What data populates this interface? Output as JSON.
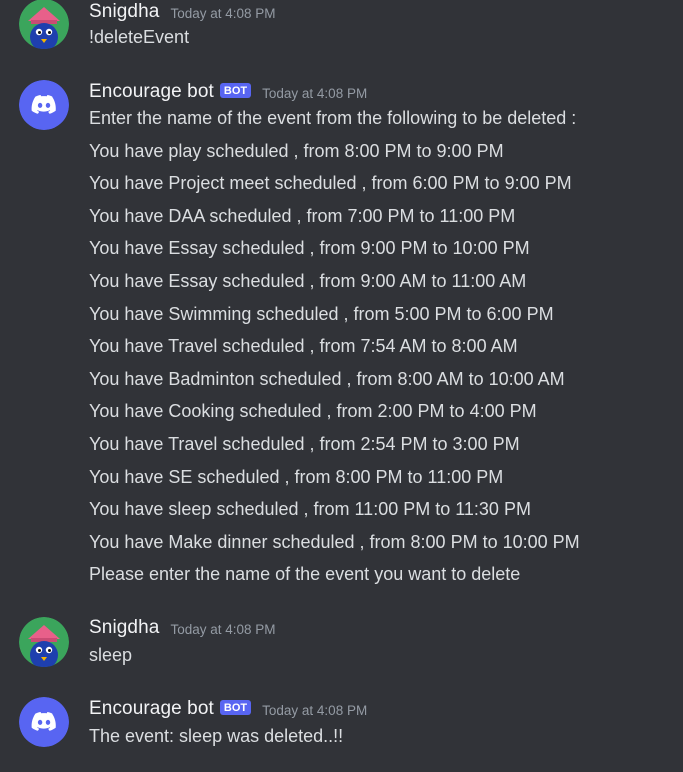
{
  "messages": [
    {
      "author": "Snigdha",
      "avatar_icon": "user-avatar-icon",
      "is_bot": false,
      "timestamp": "Today at 4:08 PM",
      "lines": [
        "!deleteEvent"
      ]
    },
    {
      "author": "Encourage bot",
      "avatar_icon": "discord-logo-icon",
      "is_bot": true,
      "badge": "BOT",
      "timestamp": "Today at 4:08 PM",
      "lines": [
        "Enter the name of the event from the following to be deleted :",
        "You have play scheduled , from 8:00 PM to 9:00 PM",
        "You have Project meet scheduled , from 6:00 PM to 9:00 PM",
        "You have DAA scheduled , from 7:00 PM to 11:00 PM",
        "You have Essay scheduled , from 9:00 PM to 10:00 PM",
        "You have Essay scheduled , from 9:00 AM to 11:00 AM",
        "You have Swimming scheduled , from 5:00 PM to 6:00 PM",
        "You have Travel scheduled , from 7:54 AM to 8:00 AM",
        "You have Badminton scheduled , from 8:00 AM to 10:00 AM",
        "You have Cooking scheduled , from 2:00 PM to 4:00 PM",
        "You have Travel scheduled , from 2:54 PM to 3:00 PM",
        "You have SE scheduled , from 8:00 PM to 11:00 PM",
        "You have sleep scheduled , from 11:00 PM to 11:30 PM",
        "You have Make dinner scheduled , from 8:00 PM to 10:00 PM",
        "Please enter the name of the event you want to delete"
      ]
    },
    {
      "author": "Snigdha",
      "avatar_icon": "user-avatar-icon",
      "is_bot": false,
      "timestamp": "Today at 4:08 PM",
      "lines": [
        "sleep"
      ]
    },
    {
      "author": "Encourage bot",
      "avatar_icon": "discord-logo-icon",
      "is_bot": true,
      "badge": "BOT",
      "timestamp": "Today at 4:08 PM",
      "lines": [
        "The event: sleep was deleted..!!"
      ]
    }
  ],
  "colors": {
    "background": "#313338",
    "username": "#f2f3f5",
    "message_text": "#dbdee1",
    "timestamp": "#949ba4",
    "bot_badge": "#5865f2",
    "user_avatar_bg": "#3ba55c",
    "bot_avatar_bg": "#5865f2"
  }
}
